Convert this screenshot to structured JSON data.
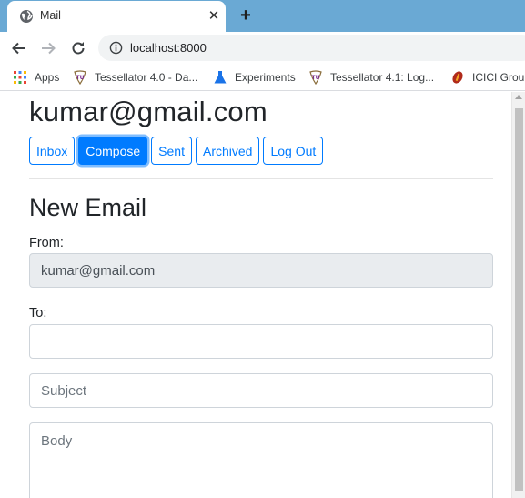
{
  "browser": {
    "tab_title": "Mail",
    "url": "localhost:8000",
    "new_tab_symbol": "+",
    "close_symbol": "✕",
    "bookmarks": [
      {
        "label": "Apps",
        "icon": "apps-grid-icon"
      },
      {
        "label": "Tessellator 4.0 - Da...",
        "icon": "tu-logo-icon"
      },
      {
        "label": "Experiments",
        "icon": "flask-icon"
      },
      {
        "label": "Tessellator 4.1: Log...",
        "icon": "tu-logo-icon"
      },
      {
        "label": "ICICI Group",
        "icon": "icici-logo-icon"
      }
    ]
  },
  "header": {
    "user_email": "kumar@gmail.com",
    "nav": [
      {
        "label": "Inbox",
        "active": false
      },
      {
        "label": "Compose",
        "active": true
      },
      {
        "label": "Sent",
        "active": false
      },
      {
        "label": "Archived",
        "active": false
      },
      {
        "label": "Log Out",
        "active": false
      }
    ]
  },
  "compose": {
    "title": "New Email",
    "from_label": "From:",
    "from_value": "kumar@gmail.com",
    "to_label": "To:",
    "to_value": "",
    "subject_placeholder": "Subject",
    "body_placeholder": "Body"
  },
  "colors": {
    "primary": "#007bff",
    "tabstrip": "#6aa9d4",
    "readonly_bg": "#e9ecef"
  }
}
